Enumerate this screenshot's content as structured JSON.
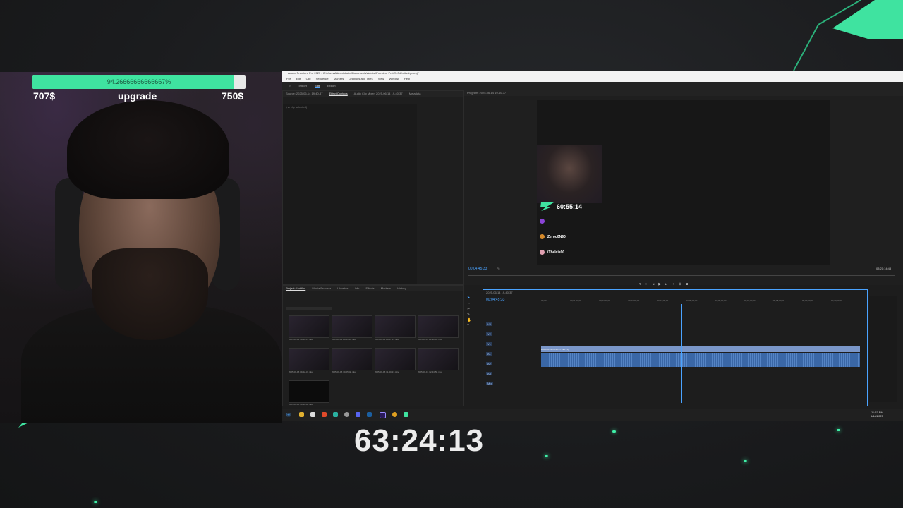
{
  "overlay": {
    "goal_percent_text": "94.26666666666667%",
    "goal_fraction": 0.9427,
    "goal_current": "707$",
    "goal_label": "upgrade",
    "goal_target": "750$",
    "stream_timer": "63:24:13",
    "accent_color": "#3fe3a0"
  },
  "premiere": {
    "window_title": "Adobe Premiere Pro 2025 - C:\\Users\\Administrator\\Documents\\Adobe\\Premiere Pro\\25.0\\Untitled.prproj *",
    "menu": [
      "File",
      "Edit",
      "Clip",
      "Sequence",
      "Markers",
      "Graphics and Titles",
      "View",
      "Window",
      "Help"
    ],
    "workspace_tabs": [
      "Import",
      "Edit",
      "Export"
    ],
    "active_workspace": "Edit",
    "source_tabs": [
      "Source: 2025-06-14 19-40-37",
      "Effect Controls",
      "Audio Clip Mixer: 2025-06-14 19-40-37",
      "Metadata"
    ],
    "effect_panel_note": "(no clip selected)",
    "program_tab": "Program: 2025-06-14 19-40-37",
    "program_timecode": "00;04;45;33",
    "program_duration": "03;21;14;48",
    "fit_label": "Fit",
    "preview": {
      "mini_timer": "60:55:14",
      "chat": [
        {
          "name": "",
          "message": "",
          "dot": "#8a44d6"
        },
        {
          "name": "Zeroo0N90",
          "message": "",
          "dot": "#d68a2a"
        },
        {
          "name": "iTheIcia90",
          "message": "",
          "dot": "#e0a0b0"
        }
      ]
    },
    "project_tabs": [
      "Project: Untitled",
      "Media Browser",
      "Libraries",
      "Info",
      "Effects",
      "Markers",
      "History"
    ],
    "project_items": [
      "2025-06-14 19-40-37.mkv",
      "2025-06-14 20-21-10.mkv",
      "2025-06-14 20-57-13.mkv",
      "2025-06-14 21-38-04.mkv",
      "2025-06-15 09-22-31.mkv",
      "2025-06-15 10-05-48.mkv",
      "2025-06-15 11-30-17.mkv",
      "2025-06-15 12-44-56.mkv",
      "2025-06-15 13-10-02.mkv"
    ],
    "timeline_tab": "2025-06-14 19-40-37",
    "timeline_timecode": "00;04;45;33",
    "ruler_ticks": [
      "00;00",
      "00;01;00;00",
      "00;02;00;00",
      "00;03;00;00",
      "00;04;00;00",
      "00;05;00;00",
      "00;06;00;00",
      "00;07;00;00",
      "00;08;00;00",
      "00;09;00;00",
      "00;10;00;00"
    ],
    "track_labels": [
      "V3",
      "V2",
      "V1",
      "A1",
      "A2",
      "A3",
      "Mix"
    ],
    "clip_label": "2025-06-14 19-40-37.mkv [V]",
    "playhead_fraction": 0.44,
    "clock_time": "11:57 PM",
    "clock_date": "6/14/2025"
  }
}
